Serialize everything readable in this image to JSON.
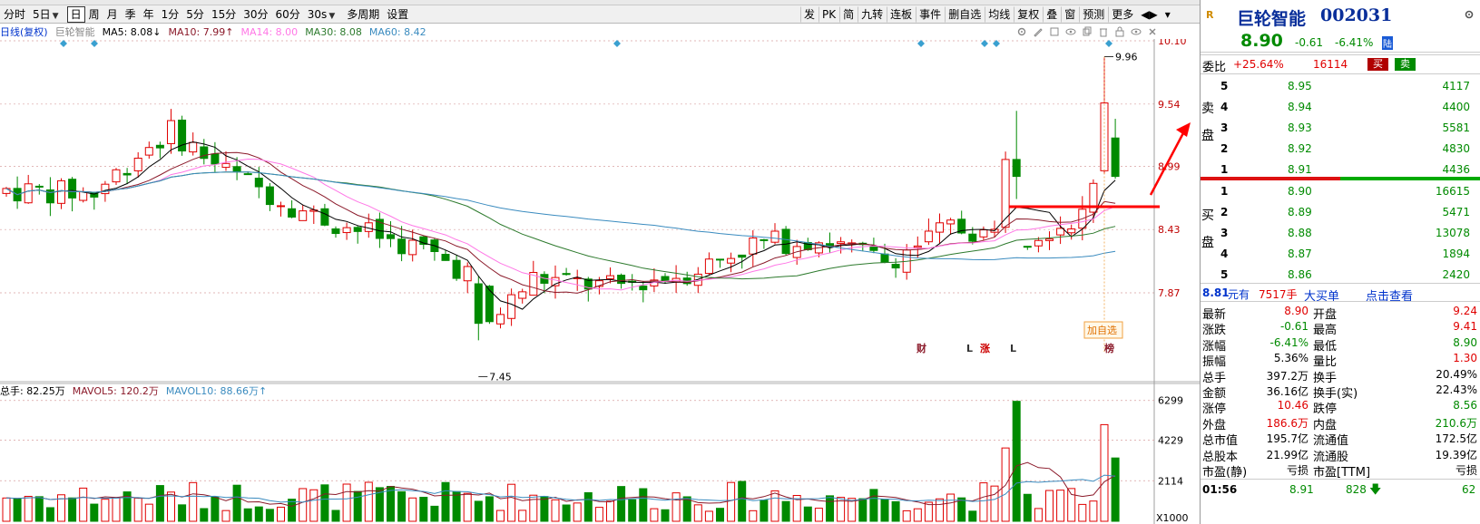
{
  "toolbar": {
    "items": [
      "分时",
      "5日",
      "日",
      "周",
      "月",
      "季",
      "年",
      "1分",
      "5分",
      "15分",
      "30分",
      "60分",
      "30s",
      "多周期",
      "设置"
    ],
    "active": "日",
    "right_items": [
      "发",
      "PK",
      "简",
      "九转",
      "连板",
      "事件",
      "删自选",
      "均线",
      "复权",
      "叠",
      "窗",
      "预测",
      "更多"
    ]
  },
  "indicators": {
    "prefix": "日线(复权)",
    "stock": "巨轮智能",
    "ma5": "MA5: 8.08↓",
    "ma10": "MA10: 7.99↑",
    "ma14": "MA14: 8.00",
    "ma30": "MA30: 8.08",
    "ma60": "MA60: 8.42"
  },
  "colors": {
    "up": "#e00000",
    "down": "#008a00",
    "ma5": "#000000",
    "ma10": "#8b1a2a",
    "ma14": "#ff77e6",
    "ma30": "#2d7a2d",
    "ma60": "#3a8bbf",
    "annot": "#ff0000"
  },
  "price_axis": [
    "10.10",
    "9.54",
    "8.99",
    "8.43",
    "7.87"
  ],
  "marks": {
    "high": "9.96",
    "low": "7.45",
    "add_fav": "加自选"
  },
  "event_marks": [
    "财",
    "L",
    "涨",
    "L",
    "榜"
  ],
  "volume": {
    "label": "总手: 82.25万",
    "mavol5": "MAVOL5: 120.2万",
    "mavol10": "MAVOL10: 88.66万↑",
    "axis": [
      "6299",
      "4229",
      "2114",
      "X1000"
    ]
  },
  "quote": {
    "logo": "R",
    "name": "巨轮智能",
    "code": "002031",
    "price": "8.90",
    "change": "-0.61",
    "pct": "-6.41%",
    "market": "陆",
    "weibi_label": "委比",
    "weibi": "+25.64%",
    "weicha": "16114",
    "buy_btn": "买",
    "sell_btn": "卖",
    "sell_label": [
      "卖",
      "盘"
    ],
    "buy_label": [
      "买",
      "盘"
    ],
    "asks": [
      {
        "lvl": "5",
        "price": "8.95",
        "vol": "4117"
      },
      {
        "lvl": "4",
        "price": "8.94",
        "vol": "4400"
      },
      {
        "lvl": "3",
        "price": "8.93",
        "vol": "5581"
      },
      {
        "lvl": "2",
        "price": "8.92",
        "vol": "4830"
      },
      {
        "lvl": "1",
        "price": "8.91",
        "vol": "4436"
      }
    ],
    "bids": [
      {
        "lvl": "1",
        "price": "8.90",
        "vol": "16615"
      },
      {
        "lvl": "2",
        "price": "8.89",
        "vol": "5471"
      },
      {
        "lvl": "3",
        "price": "8.88",
        "vol": "13078"
      },
      {
        "lvl": "4",
        "price": "8.87",
        "vol": "1894"
      },
      {
        "lvl": "5",
        "price": "8.86",
        "vol": "2420"
      }
    ],
    "order_price": "8.81",
    "order_unit": "元有",
    "order_vol": "7517手",
    "big_order": "大买单",
    "view": "点击查看",
    "stats": [
      [
        "最新",
        "8.90",
        "开盘",
        "9.24"
      ],
      [
        "涨跌",
        "-0.61",
        "最高",
        "9.41"
      ],
      [
        "涨幅",
        "-6.41%",
        "最低",
        "8.90"
      ],
      [
        "振幅",
        "5.36%",
        "量比",
        "1.30"
      ],
      [
        "总手",
        "397.2万",
        "换手",
        "20.49%"
      ],
      [
        "金额",
        "36.16亿",
        "换手(实)",
        "22.43%"
      ],
      [
        "涨停",
        "10.46",
        "跌停",
        "8.56"
      ],
      [
        "外盘",
        "186.6万",
        "内盘",
        "210.6万"
      ],
      [
        "总市值",
        "195.7亿",
        "流通值",
        "172.5亿"
      ],
      [
        "总股本",
        "21.99亿",
        "流通股",
        "19.39亿"
      ],
      [
        "市盈(静)",
        "亏损",
        "市盈[TTM]",
        "亏损"
      ]
    ],
    "tick_time": "01:56",
    "tick_price": "8.91",
    "tick_vol": "828",
    "tick_extra": "62"
  }
}
